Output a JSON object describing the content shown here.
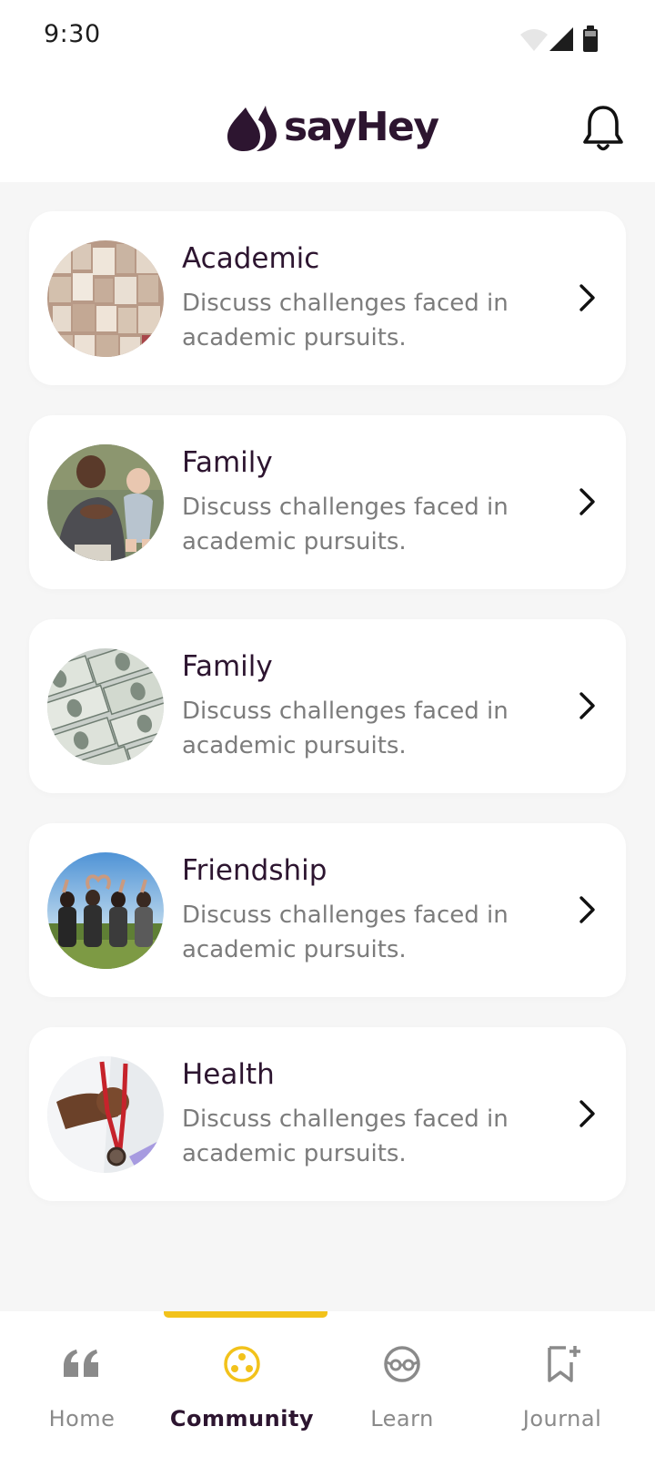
{
  "status_bar": {
    "time": "9:30"
  },
  "header": {
    "logo_text": "sayHey"
  },
  "topics": [
    {
      "title": "Academic",
      "description": "Discuss challenges faced in academic pursuits.",
      "image": "books-photo"
    },
    {
      "title": "Family",
      "description": "Discuss challenges faced in academic pursuits.",
      "image": "father-baby-photo"
    },
    {
      "title": "Family",
      "description": "Discuss challenges faced in academic pursuits.",
      "image": "money-photo"
    },
    {
      "title": "Friendship",
      "description": "Discuss challenges faced in academic pursuits.",
      "image": "friends-heart-photo"
    },
    {
      "title": "Health",
      "description": "Discuss challenges faced in academic pursuits.",
      "image": "stethoscope-photo"
    }
  ],
  "nav": {
    "active": "Community",
    "items": [
      {
        "label": "Home",
        "icon": "quote-icon"
      },
      {
        "label": "Community",
        "icon": "community-icon"
      },
      {
        "label": "Learn",
        "icon": "glasses-icon"
      },
      {
        "label": "Journal",
        "icon": "bookmark-add-icon"
      }
    ]
  },
  "colors": {
    "accent": "#f2c21b",
    "brand": "#2d1530",
    "muted_text": "#7c7c7c",
    "background": "#f6f6f6"
  }
}
